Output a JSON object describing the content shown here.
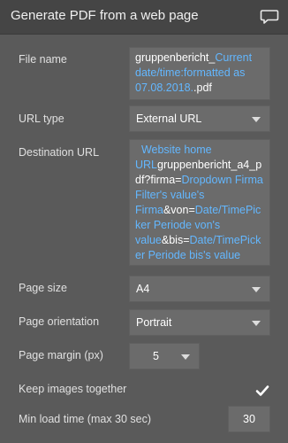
{
  "panel": {
    "title": "Generate PDF from a web page",
    "icon": "comment-icon"
  },
  "file_name": {
    "label": "File name",
    "parts": [
      {
        "text": "gruppenbericht_",
        "dynamic": false
      },
      {
        "text": "Current date/time:formatted as 07.08.2018.",
        "dynamic": true
      },
      {
        "text": ".pdf",
        "dynamic": false
      }
    ]
  },
  "url_type": {
    "label": "URL type",
    "value": "External URL"
  },
  "destination_url": {
    "label": "Destination URL",
    "parts": [
      {
        "text": "  Website home URL",
        "dynamic": true
      },
      {
        "text": "gruppenbericht_a4_pdf?firma=",
        "dynamic": false
      },
      {
        "text": "Dropdown Firma Filter's value's Firma",
        "dynamic": true
      },
      {
        "text": "&von=",
        "dynamic": false
      },
      {
        "text": "Date/TimePicker Periode von's value",
        "dynamic": true
      },
      {
        "text": "&bis=",
        "dynamic": false
      },
      {
        "text": "Date/TimePicker Periode bis's value",
        "dynamic": true
      }
    ]
  },
  "page_size": {
    "label": "Page size",
    "value": "A4"
  },
  "page_orientation": {
    "label": "Page orientation",
    "value": "Portrait"
  },
  "page_margin": {
    "label": "Page margin (px)",
    "value": "5"
  },
  "keep_images": {
    "label": "Keep images together",
    "checked": true
  },
  "min_load_time": {
    "label": "Min load time (max 30 sec)",
    "value": "30"
  },
  "colors": {
    "dynamic": "#63b7ff",
    "panel_bg": "#5a5a5a",
    "title_bg": "#454545"
  }
}
